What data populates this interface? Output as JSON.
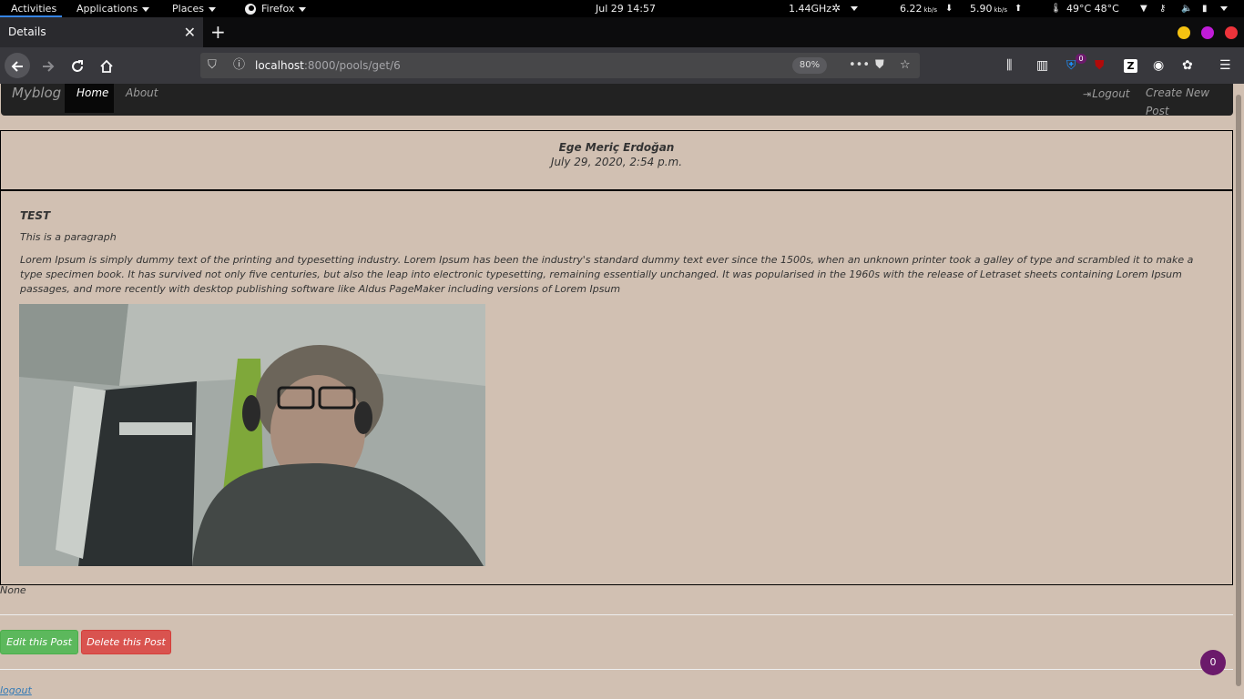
{
  "system_bar": {
    "activities": "Activities",
    "applications": "Applications",
    "places": "Places",
    "firefox": "Firefox",
    "clock": "Jul 29  14:57",
    "cpu_freq": "1.44GHz",
    "net_down": "6.22",
    "net_down_unit": "kb/s",
    "net_up": "5.90",
    "net_up_unit": "kb/s",
    "temps": "49°C 48°C"
  },
  "browser": {
    "tab_title": "Details",
    "url_host": "localhost",
    "url_rest": ":8000/pools/get/6",
    "zoom": "80%",
    "badge_count": "0",
    "window_buttons": {
      "minimize": "#f5c211",
      "maximize": "#c01cd8",
      "close": "#ed333b"
    }
  },
  "navbar": {
    "brand": "Myblog",
    "home": "Home",
    "about": "About",
    "logout": "Logout",
    "create": "Create New Post"
  },
  "post": {
    "author": "Ege Meriç Erdoğan",
    "date": "July 29, 2020, 2:54 p.m.",
    "title": "TEST",
    "paragraph": "This is a paragraph",
    "body": "Lorem Ipsum is simply dummy text of the printing and typesetting industry. Lorem Ipsum has been the industry's standard dummy text ever since the 1500s, when an unknown printer took a galley of type and scrambled it to make a type specimen book. It has survived not only five centuries, but also the leap into electronic typesetting, remaining essentially unchanged. It was popularised in the 1960s with the release of Letraset sheets containing Lorem Ipsum passages, and more recently with desktop publishing software like Aldus PageMaker including versions of Lorem Ipsum",
    "extra": "None"
  },
  "actions": {
    "edit": "Edit this Post",
    "delete": "Delete this Post",
    "logout_link": "logout"
  },
  "floating_badge": "0"
}
